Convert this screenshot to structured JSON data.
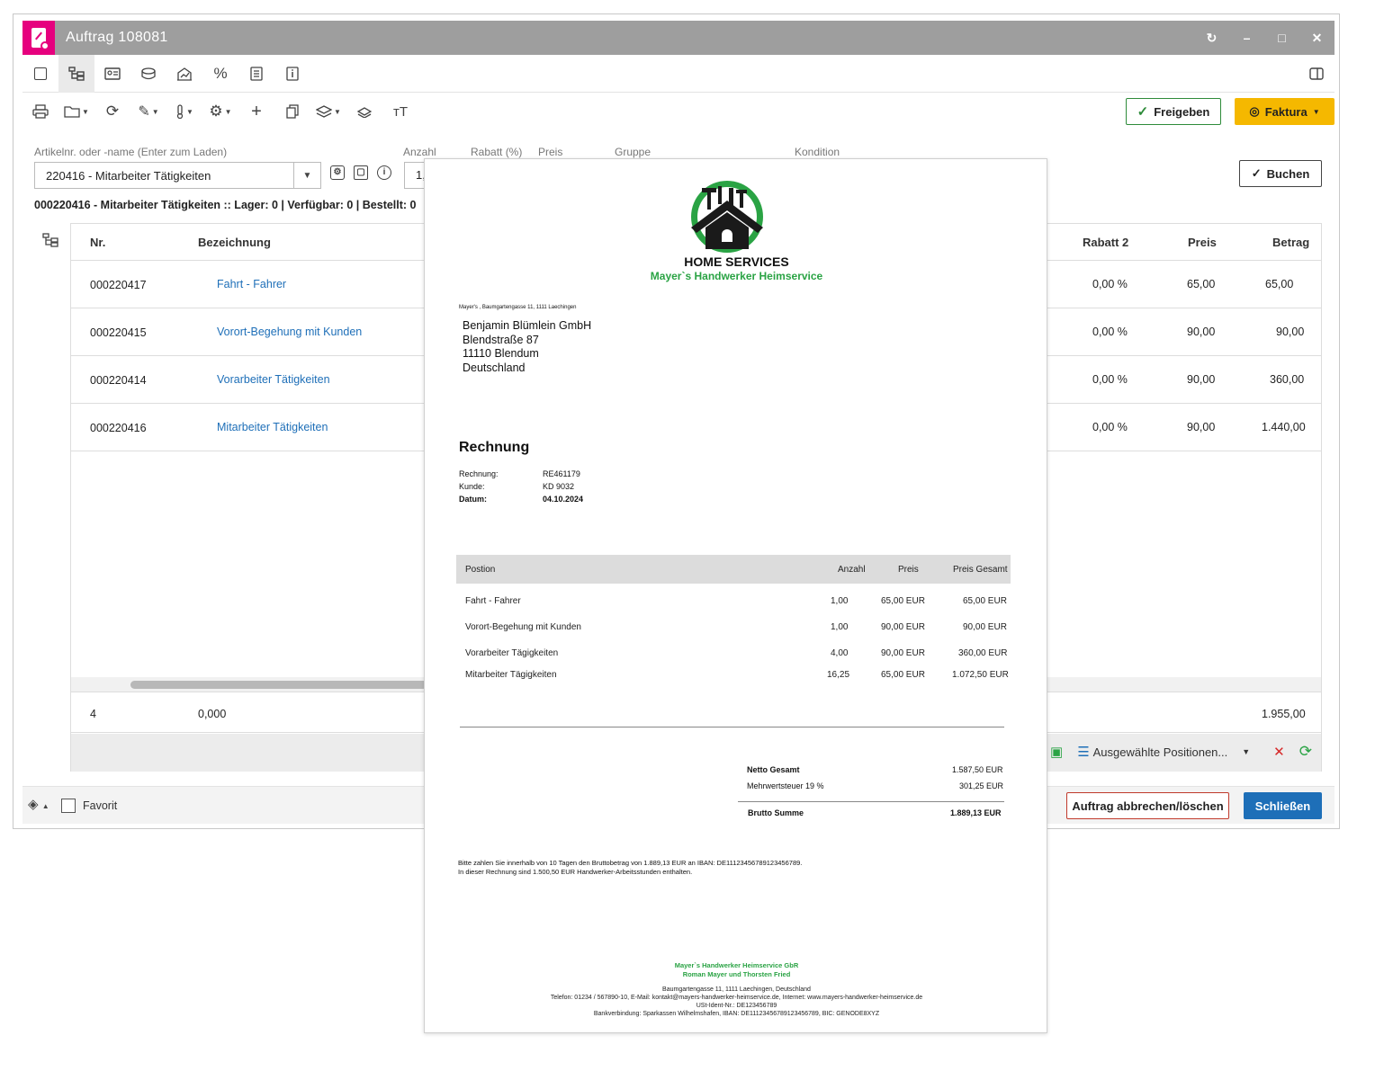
{
  "window": {
    "title": "Auftrag 108081",
    "controls": [
      "↻",
      "–",
      "□",
      "✕"
    ]
  },
  "toolbar": {
    "freigeben_label": "Freigeben",
    "faktura_label": "Faktura"
  },
  "form": {
    "article_label": "Artikelnr. oder -name (Enter zum Laden)",
    "article_value": "220416 - Mitarbeiter Tätigkeiten",
    "anzahl_label": "Anzahl",
    "anzahl_value": "1,",
    "rabatt_label": "Rabatt (%)",
    "preis_label": "Preis",
    "gruppe_label": "Gruppe",
    "kondition_label": "Kondition",
    "buchen_label": "Buchen",
    "article_info": "000220416 - Mitarbeiter Tätigkeiten :: Lager: 0 | Verfügbar: 0 | Bestellt: 0"
  },
  "grid": {
    "headers": {
      "nr": "Nr.",
      "bezeichnung": "Bezeichnung",
      "rabatt2": "Rabatt 2",
      "preis": "Preis",
      "betrag": "Betrag"
    },
    "rows": [
      {
        "nr": "000220417",
        "bezeichnung": "Fahrt - Fahrer",
        "rabatt2": "0,00 %",
        "preis": "65,00",
        "betrag": "65,00"
      },
      {
        "nr": "000220415",
        "bezeichnung": "Vorort-Begehung mit Kunden",
        "rabatt2": "0,00 %",
        "preis": "90,00",
        "betrag": "90,00"
      },
      {
        "nr": "000220414",
        "bezeichnung": "Vorarbeiter Tätigkeiten",
        "rabatt2": "0,00 %",
        "preis": "90,00",
        "betrag": "360,00"
      },
      {
        "nr": "000220416",
        "bezeichnung": "Mitarbeiter Tätigkeiten",
        "rabatt2": "0,00 %",
        "preis": "90,00",
        "betrag": "1.440,00"
      }
    ],
    "footer": {
      "count": "4",
      "quantity": "0,000",
      "total": "1.955,00"
    },
    "selected_positions_label": "Ausgewählte Positionen..."
  },
  "footer": {
    "favorit_label": "Favorit",
    "abbrechen_label": "Auftrag abbrechen/löschen",
    "schliessen_label": "Schließen"
  },
  "invoice": {
    "brand_title": "HOME SERVICES",
    "brand_subtitle": "Mayer`s Handwerker Heimservice",
    "sender_line": "Mayer's , Baumgartengasse 11, 1111 Laechingen",
    "recipient": [
      "Benjamin Blümlein GmbH",
      "Blendstraße 87",
      "11110 Blendum",
      "Deutschland"
    ],
    "heading": "Rechnung",
    "meta": [
      {
        "label": "Rechnung:",
        "value": "RE461179"
      },
      {
        "label": "Kunde:",
        "value": "KD 9032"
      },
      {
        "label": "Datum:",
        "value": "04.10.2024"
      }
    ],
    "table_headers": {
      "position": "Postion",
      "anzahl": "Anzahl",
      "preis": "Preis",
      "gesamt": "Preis Gesamt"
    },
    "items": [
      {
        "position": "Fahrt - Fahrer",
        "anzahl": "1,00",
        "preis": "65,00 EUR",
        "gesamt": "65,00 EUR"
      },
      {
        "position": "Vorort-Begehung mit Kunden",
        "anzahl": "1,00",
        "preis": "90,00 EUR",
        "gesamt": "90,00 EUR"
      },
      {
        "position": "Vorarbeiter Tägigkeiten",
        "anzahl": "4,00",
        "preis": "90,00 EUR",
        "gesamt": "360,00 EUR"
      },
      {
        "position": "Mitarbeiter Tägigkeiten",
        "anzahl": "16,25",
        "preis": "65,00 EUR",
        "gesamt": "1.072,50 EUR"
      }
    ],
    "totals": {
      "netto_label": "Netto Gesamt",
      "netto_value": "1.587,50 EUR",
      "mwst_label": "Mehrwertsteuer 19 %",
      "mwst_value": "301,25 EUR",
      "brutto_label": "Brutto Summe",
      "brutto_value": "1.889,13 EUR"
    },
    "payment_note_1": "Bitte zahlen Sie innerhalb von 10 Tagen den Bruttobetrag von 1.889,13 EUR an IBAN: DE11123456789123456789.",
    "payment_note_2": "In dieser Rechnung sind 1.500,50 EUR Handwerker-Arbeitsstunden enthalten.",
    "company_footer_1": "Mayer`s Handwerker Heimservice GbR",
    "company_footer_2": "Roman Mayer und Thorsten Fried",
    "address_footer": "Baumgartengasse 11, 1111 Laechingen, Deutschland",
    "contact_footer": "Telefon: 01234 / 567890-10, E-Mail: kontakt@mayers-handwerker-heimservice.de, Internet: www.mayers-handwerker-heimservice.de",
    "ust_footer": "USt-Ident-Nr.: DE123456789",
    "bank_footer": "Bankverbindung: Sparkassen Wilhelmshafen, IBAN: DE11123456789123456789, BIC: GENODE8XYZ"
  },
  "colors": {
    "accent": "#e6007e",
    "link": "#1e6fb8",
    "brand_green": "#2aa344",
    "faktura": "#f5b800"
  }
}
